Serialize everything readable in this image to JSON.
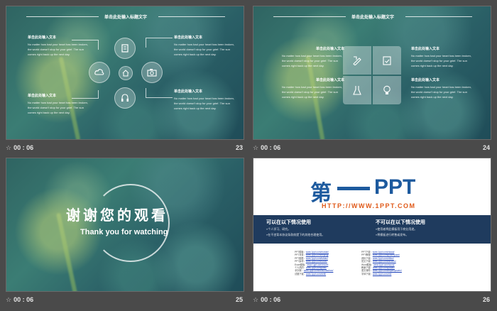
{
  "colors": {
    "background": "#4a4a4a",
    "slide_teal": "#2f6462",
    "brand_blue": "#1d5a9e",
    "brand_orange": "#e05a1a",
    "band_navy": "#1f3b5e"
  },
  "footer_icon": "star-icon",
  "slides": [
    {
      "number": "23",
      "time": "00 : 06",
      "title": "单击此处输入标题文字",
      "blocks": [
        {
          "heading": "单击此处输入文本",
          "body": "No matter how bad your heart has been broken, the world doesn't stop for your grief. The sun comes right back up the next day."
        },
        {
          "heading": "单击此处输入文本",
          "body": "No matter how bad your heart has been broken, the world doesn't stop for your grief. The sun comes right back up the next day."
        },
        {
          "heading": "单击此处输入文本",
          "body": "No matter how bad your heart has been broken, the world doesn't stop for your grief. The sun comes right back up the next day."
        },
        {
          "heading": "单击此处输入文本",
          "body": "No matter how bad your heart has been broken, the world doesn't stop for your grief. The sun comes right back up the next day."
        }
      ],
      "icons": [
        "document-icon",
        "cloud-icon",
        "home-icon",
        "camera-icon",
        "headphones-icon"
      ]
    },
    {
      "number": "24",
      "time": "00 : 06",
      "title": "单击此处输入标题文字",
      "blocks": [
        {
          "heading": "单击此处输入文本",
          "body": "No matter how bad your heart has been broken, the world doesn't stop for your grief. The sun comes right back up the next day."
        },
        {
          "heading": "单击此处输入文本",
          "body": "No matter how bad your heart has been broken, the world doesn't stop for your grief. The sun comes right back up the next day."
        },
        {
          "heading": "单击此处输入文本",
          "body": "No matter how bad your heart has been broken, the world doesn't stop for your grief. The sun comes right back up the next day."
        },
        {
          "heading": "单击此处输入文本",
          "body": "No matter how bad your heart has been broken, the world doesn't stop for your grief. The sun comes right back up the next day."
        }
      ],
      "icons": [
        "pencil-ruler-icon",
        "clipboard-check-icon",
        "flask-icon",
        "lightbulb-icon"
      ]
    },
    {
      "number": "25",
      "time": "00 : 06",
      "title_cn": "谢谢您的观看",
      "title_en": "Thank you  for watching"
    },
    {
      "number": "26",
      "time": "00 : 06",
      "logo_cn": "第",
      "logo_en": "PPT",
      "url": "HTTP://WWW.1PPT.COM",
      "left_heading": "可以在以下情况使用",
      "left_lines": [
        "»个人学习、研究。",
        "»在不违背本协议条款前提下的其他合理使用。"
      ],
      "right_heading": "不可以在以下情况使用",
      "right_lines": [
        "»使用者将此模板用于商业用途。",
        "»将模板进行转售或发布。"
      ],
      "links_left": [
        {
          "label": "PPT模板：",
          "url": "www.1ppt.com/moban/"
        },
        {
          "label": "PPT背景：",
          "url": "www.1ppt.com/beijing/"
        },
        {
          "label": "PPT图表：",
          "url": "www.1ppt.com/tubiao/"
        },
        {
          "label": "PPT素材：",
          "url": "www.1ppt.com/sucai/"
        },
        {
          "label": "Excel模板：",
          "url": "www.1ppt.com/excel/"
        },
        {
          "label": "个人简历：",
          "url": "www.1ppt.com/jianli/"
        },
        {
          "label": "手抄报：",
          "url": "www.1ppt.com/shouchaobao/"
        },
        {
          "label": "试题下载：",
          "url": "www.1ppt.com/shiti/"
        }
      ],
      "links_right": [
        {
          "label": "PPT下载：",
          "url": "www.1ppt.com/xiazai/"
        },
        {
          "label": "PPT教程：",
          "url": "www.1ppt.com/powerpoint/"
        },
        {
          "label": "资料下载：",
          "url": "www.1ppt.com/ziliao/"
        },
        {
          "label": "范文下载：",
          "url": "www.1ppt.com/fanwen/"
        },
        {
          "label": "Word模板：",
          "url": "www.1ppt.com/word/"
        },
        {
          "label": "教案下载：",
          "url": "www.1ppt.com/jiaoan/"
        },
        {
          "label": "语文课件：",
          "url": "www.1ppt.com/kejian/yuwen/"
        },
        {
          "label": "字体下载：",
          "url": "www.1ppt.com/ziti/"
        }
      ]
    }
  ]
}
